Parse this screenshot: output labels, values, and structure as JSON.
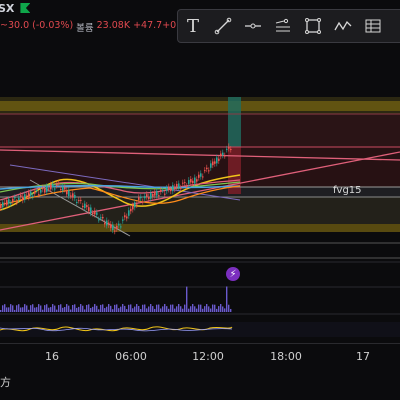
{
  "header": {
    "symbol_fragment": "SX",
    "price_change": "~30.0 (-0.03%)",
    "volume_label": "볼륨",
    "volume_value": "23.08K",
    "extra_value": "+47.7+0"
  },
  "toolbar": {
    "tools": [
      {
        "name": "text-tool",
        "label": "T"
      },
      {
        "name": "trendline-tool"
      },
      {
        "name": "horizontal-line-tool"
      },
      {
        "name": "parallel-channel-tool"
      },
      {
        "name": "rectangle-tool"
      },
      {
        "name": "path-tool"
      },
      {
        "name": "table-tool"
      }
    ]
  },
  "annotations": {
    "fvg_label": "fvg15"
  },
  "x_axis": {
    "ticks": [
      "16",
      "06:00",
      "12:00",
      "18:00",
      "17"
    ]
  },
  "bottom_fragment": "方",
  "colors": {
    "background": "#0b0b0d",
    "up": "#26a69a",
    "down": "#ef5350",
    "ema_yellow": "#f0c419",
    "ema_pink": "#e0607a",
    "ema_green": "#7cc44f",
    "ema_blue": "#4aa3df",
    "zone_gold": "#6b5a12",
    "zone_red": "#5a1e22"
  }
}
